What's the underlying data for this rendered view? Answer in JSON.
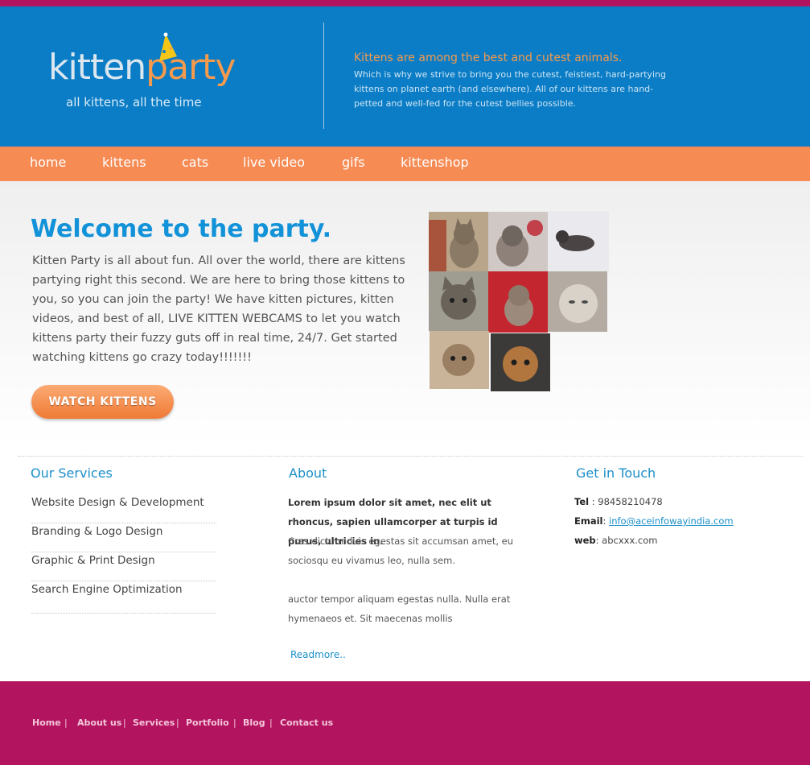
{
  "brand": {
    "logo_kitten": "kitten",
    "logo_party": "party",
    "tagline": "all kittens, all the time"
  },
  "header": {
    "headline": "Kittens are among the best and cutest animals.",
    "body": "Which is why we strive to bring you the cutest, feistiest, hard-partying kittens on planet earth (and elsewhere). All of our kittens are hand-petted and well-fed for the cutest bellies possible."
  },
  "nav": {
    "items": [
      {
        "label": "home"
      },
      {
        "label": "kittens"
      },
      {
        "label": "cats"
      },
      {
        "label": "live video"
      },
      {
        "label": "gifs"
      },
      {
        "label": "kittenshop"
      }
    ]
  },
  "hero": {
    "title": "Welcome to the party.",
    "text": "Kitten Party is all about fun. All over the world, there are kittens partying right this second. We are here to bring those kittens to you, so you can join the party! We have kitten pictures, kitten videos, and best of all, LIVE KITTEN WEBCAMS to let you watch kittens party their fuzzy guts off in real time, 24/7. Get started watching kittens go crazy today!!!!!!!",
    "cta_label": "WATCH KITTENS"
  },
  "services": {
    "title": "Our Services",
    "items": [
      {
        "label": "Website Design & Development"
      },
      {
        "label": "Branding & Logo Design"
      },
      {
        "label": "Graphic & Print Design"
      },
      {
        "label": "Search Engine Optimization"
      }
    ]
  },
  "about": {
    "title": "About",
    "lead": "Lorem ipsum dolor sit amet, nec elit ut rhoncus, sapien ullamcorper at turpis id purus, ultricies in.",
    "para1": "Cras dictum duis egestas sit accumsan amet, eu sociosqu eu vivamus leo, nulla sem.",
    "para2": "auctor tempor aliquam egestas nulla. Nulla erat hymenaeos et. Sit maecenas mollis",
    "readmore": "Readmore.."
  },
  "contact": {
    "title": "Get in Touch",
    "tel_label": "Tel",
    "tel_value": " : 98458210478",
    "email_label": "Email",
    "email_value": "info@aceinfowayindia.com",
    "web_label": "web",
    "web_value": ": abcxxx.com"
  },
  "footer": {
    "links": [
      {
        "label": "Home"
      },
      {
        "label": "About us"
      },
      {
        "label": "Services"
      },
      {
        "label": "Portfolio"
      },
      {
        "label": "Blog"
      },
      {
        "label": "Contact us"
      }
    ]
  },
  "colors": {
    "header_blue": "#0a7dc6",
    "nav_orange": "#f68b54",
    "footer_magenta": "#b3145f",
    "title_blue": "#1292d8"
  }
}
